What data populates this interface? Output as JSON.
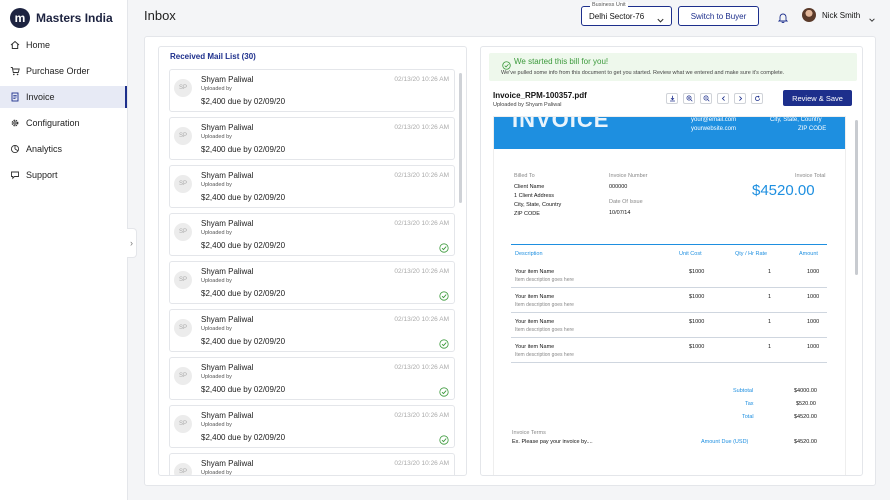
{
  "brand": {
    "logo_letter": "m",
    "name": "Masters India"
  },
  "sidebar": {
    "items": [
      {
        "label": "Home",
        "icon": "home-icon"
      },
      {
        "label": "Purchase Order",
        "icon": "cart-icon"
      },
      {
        "label": "Invoice",
        "icon": "document-icon",
        "active": true
      },
      {
        "label": "Configuration",
        "icon": "gear-icon"
      },
      {
        "label": "Analytics",
        "icon": "analytics-icon"
      },
      {
        "label": "Support",
        "icon": "support-icon"
      }
    ],
    "collapse_glyph": "›"
  },
  "header": {
    "title": "Inbox",
    "business_unit_label": "Business Unit",
    "business_unit_value": "Delhi Sector-76",
    "switch_button": "Switch to Buyer",
    "user_name": "Nick Smith"
  },
  "mail": {
    "heading": "Received Mail List (30)",
    "items": [
      {
        "initials": "SP",
        "name": "Shyam Paliwal",
        "uploaded": "Uploaded by",
        "due": "$2,400 due by 02/09/20",
        "time": "02/13/20 10:26 AM",
        "checked": false
      },
      {
        "initials": "SP",
        "name": "Shyam Paliwal",
        "uploaded": "Uploaded by",
        "due": "$2,400 due by 02/09/20",
        "time": "02/13/20 10:26 AM",
        "checked": false
      },
      {
        "initials": "SP",
        "name": "Shyam Paliwal",
        "uploaded": "Uploaded by",
        "due": "$2,400 due by 02/09/20",
        "time": "02/13/20 10:26 AM",
        "checked": false
      },
      {
        "initials": "SP",
        "name": "Shyam Paliwal",
        "uploaded": "Uploaded by",
        "due": "$2,400 due by 02/09/20",
        "time": "02/13/20 10:26 AM",
        "checked": true
      },
      {
        "initials": "SP",
        "name": "Shyam Paliwal",
        "uploaded": "Uploaded by",
        "due": "$2,400 due by 02/09/20",
        "time": "02/13/20 10:26 AM",
        "checked": true
      },
      {
        "initials": "SP",
        "name": "Shyam Paliwal",
        "uploaded": "Uploaded by",
        "due": "$2,400 due by 02/09/20",
        "time": "02/13/20 10:26 AM",
        "checked": true
      },
      {
        "initials": "SP",
        "name": "Shyam Paliwal",
        "uploaded": "Uploaded by",
        "due": "$2,400 due by 02/09/20",
        "time": "02/13/20 10:26 AM",
        "checked": true
      },
      {
        "initials": "SP",
        "name": "Shyam Paliwal",
        "uploaded": "Uploaded by",
        "due": "$2,400 due by 02/09/20",
        "time": "02/13/20 10:26 AM",
        "checked": true
      },
      {
        "initials": "SP",
        "name": "Shyam Paliwal",
        "uploaded": "Uploaded by",
        "due": "$2,400 due by 02/09/20",
        "time": "02/13/20 10:26 AM",
        "checked": false
      }
    ]
  },
  "invoice_panel": {
    "banner_title": "We started this bill for you!",
    "banner_message": "We've pulled some info from this document to get you started. Review what we entered and make sure it's complete.",
    "file_name": "Invoice_RPM-100357.pdf",
    "uploaded_by": "Uploaded by Shyam Paliwal",
    "save_button": "Review & Save",
    "toolbar_icons": [
      "download-icon",
      "zoom-in-icon",
      "zoom-out-icon",
      "chevron-left-icon",
      "chevron-right-icon",
      "refresh-icon"
    ]
  },
  "document": {
    "band_title": "INVOICE",
    "email": "your@email.com",
    "website": "yourwebsite.com",
    "city_state_country": "City, State, Country",
    "zip_code": "ZIP CODE",
    "billed_to_label": "Billed To",
    "client_name": "Client Name",
    "client_address": "1 Client Address",
    "client_city": "City, State, Country",
    "client_zip": "ZIP CODE",
    "invoice_number_label": "Invoice Number",
    "invoice_number": "000000",
    "date_of_issue_label": "Date Of Issue",
    "date_of_issue": "10/07/14",
    "invoice_total_label": "Invoice Total",
    "invoice_total": "$4520.00",
    "columns": {
      "description": "Description",
      "unit_cost": "Unit Cost",
      "qty": "Qty / Hr Rate",
      "amount": "Amount"
    },
    "rows": [
      {
        "name": "Your item Name",
        "desc": "Item description goes here",
        "unit_cost": "$1000",
        "qty": "1",
        "amount": "1000"
      },
      {
        "name": "Your item Name",
        "desc": "Item description goes here",
        "unit_cost": "$1000",
        "qty": "1",
        "amount": "1000"
      },
      {
        "name": "Your item Name",
        "desc": "Item description goes here",
        "unit_cost": "$1000",
        "qty": "1",
        "amount": "1000"
      },
      {
        "name": "Your item Name",
        "desc": "Item description goes here",
        "unit_cost": "$1000",
        "qty": "1",
        "amount": "1000"
      }
    ],
    "subtotal_label": "Subtotal",
    "subtotal": "$4000.00",
    "tax_label": "Tax",
    "tax": "$520.00",
    "total_label": "Total",
    "total": "$4520.00",
    "terms_label": "Invoice Terms",
    "terms_text": "Ex. Please pay your invoice by....",
    "amount_due_label": "Amount Due (USD)",
    "amount_due": "$4520.00"
  },
  "colors": {
    "primary": "#1d2f8c",
    "invoice_blue": "#1e8fe0",
    "success": "#3c9a3c"
  }
}
